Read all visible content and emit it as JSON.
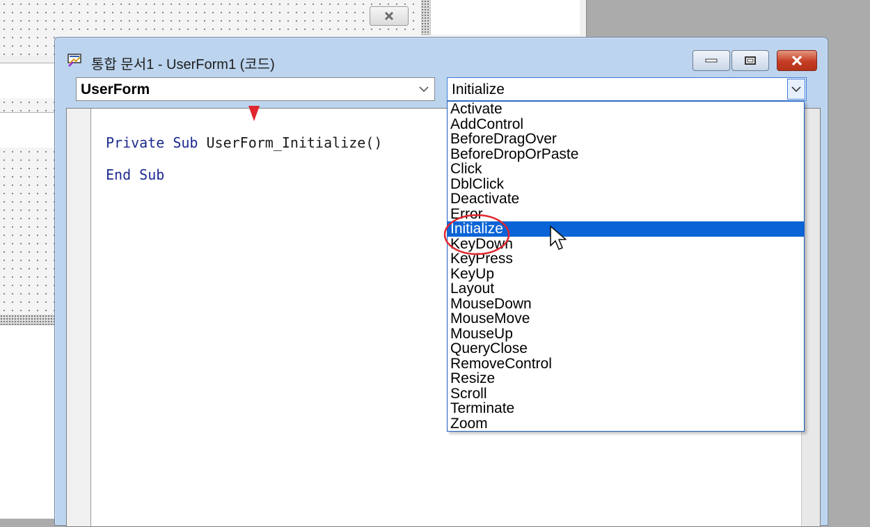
{
  "window": {
    "title": "통합 문서1 - UserForm1 (코드)",
    "minimize_glyph": "—",
    "maximize_glyph": "□",
    "close_glyph": "✕"
  },
  "object_combo": {
    "value": "UserForm"
  },
  "procedure_combo": {
    "value": "Initialize"
  },
  "code": {
    "line1": {
      "kw1": "Private",
      "kw2": "Sub",
      "name": "UserForm_Initialize()"
    },
    "line2": {
      "kw1": "End",
      "kw2": "Sub"
    }
  },
  "procedure_list": {
    "items": [
      "Activate",
      "AddControl",
      "BeforeDragOver",
      "BeforeDropOrPaste",
      "Click",
      "DblClick",
      "Deactivate",
      "Error",
      "Initialize",
      "KeyDown",
      "KeyPress",
      "KeyUp",
      "Layout",
      "MouseDown",
      "MouseMove",
      "MouseUp",
      "QueryClose",
      "RemoveControl",
      "Resize",
      "Scroll",
      "Terminate",
      "Zoom"
    ],
    "selected": "Initialize"
  },
  "colors": {
    "selection": "#0a64d6",
    "keyword": "#1d2b8f",
    "annotation": "#e0262e"
  },
  "icons": {
    "title": "code-window-icon",
    "dropdown": "chevron-down-icon",
    "cursor": "mouse-pointer-icon"
  }
}
